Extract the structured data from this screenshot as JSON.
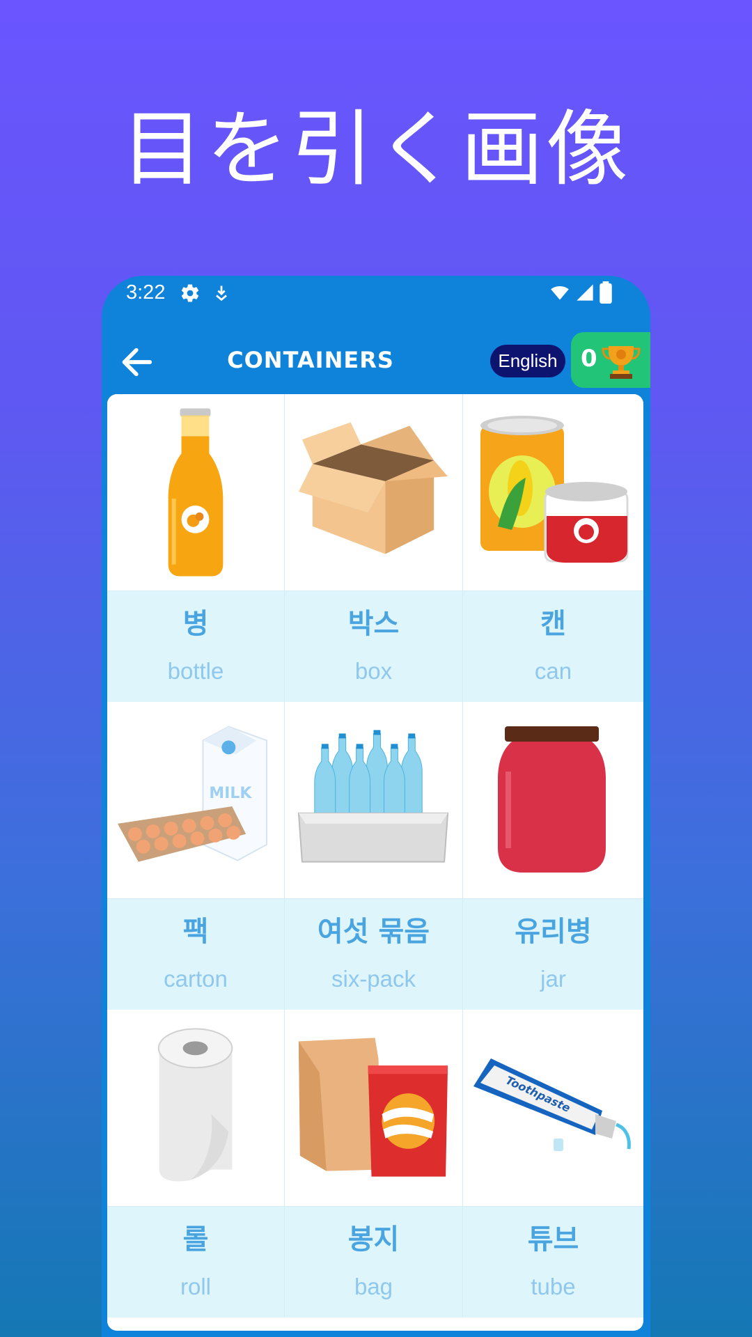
{
  "headline": "目を引く画像",
  "status": {
    "time": "3:22",
    "icons": [
      "gear-icon",
      "download-icon",
      "wifi-icon",
      "signal-icon",
      "battery-icon"
    ]
  },
  "appbar": {
    "title": "CONTAINERS",
    "language": "English",
    "score": "0"
  },
  "items": [
    {
      "ko": "병",
      "en": "bottle",
      "icon": "bottle-image"
    },
    {
      "ko": "박스",
      "en": "box",
      "icon": "box-image"
    },
    {
      "ko": "캔",
      "en": "can",
      "icon": "can-image"
    },
    {
      "ko": "팩",
      "en": "carton",
      "icon": "carton-image"
    },
    {
      "ko": "여섯 묶음",
      "en": "six-pack",
      "icon": "six-pack-image"
    },
    {
      "ko": "유리병",
      "en": "jar",
      "icon": "jar-image"
    },
    {
      "ko": "롤",
      "en": "roll",
      "icon": "roll-image"
    },
    {
      "ko": "봉지",
      "en": "bag",
      "icon": "bag-image"
    },
    {
      "ko": "튜브",
      "en": "tube",
      "icon": "tube-image"
    }
  ],
  "colors": {
    "background_top": "#6a55fe",
    "background_bottom": "#1478b4",
    "appbar": "#0f82da",
    "language_pill": "#0d1470",
    "score_badge": "#22c477",
    "label_bg": "#def5fc",
    "korean_text": "#4aa4e0",
    "english_text": "#8fc8ec"
  }
}
